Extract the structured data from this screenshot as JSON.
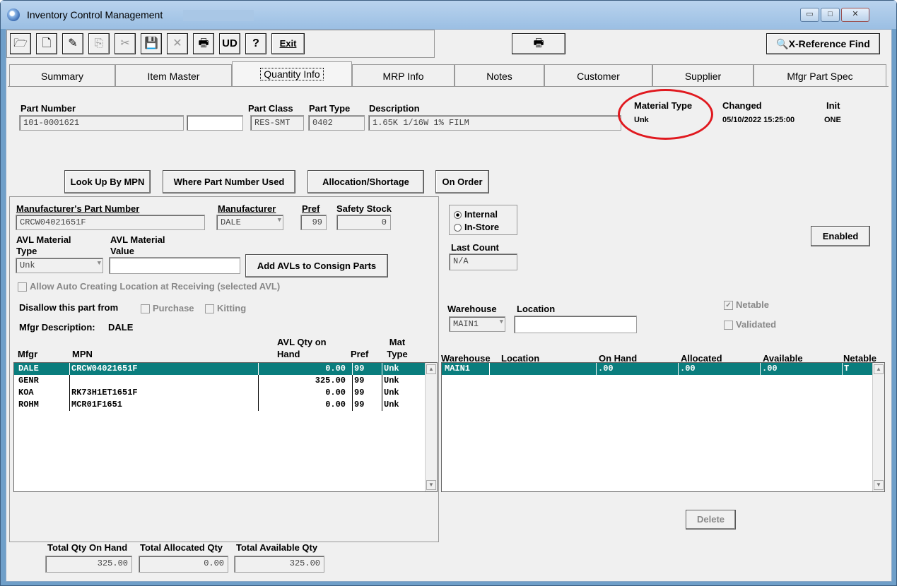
{
  "window": {
    "title": "Inventory Control Management",
    "min": "▭",
    "max": "□",
    "close": "✕"
  },
  "toolbar": {
    "exit_label": "Exit",
    "print": "🖶",
    "xref_label": "X-Reference Find"
  },
  "tabs": [
    "Summary",
    "Item Master",
    "Quantity Info",
    "MRP Info",
    "Notes",
    "Customer",
    "Supplier",
    "Mfgr Part Spec"
  ],
  "header": {
    "part_number_label": "Part Number",
    "part_number": "101-0001621",
    "part_class_label": "Part Class",
    "part_class": "RES-SMT",
    "part_type_label": "Part Type",
    "part_type": "0402",
    "description_label": "Description",
    "description": "1.65K 1/16W 1% FILM",
    "material_type_label": "Material Type",
    "material_type": "Unk",
    "changed_label": "Changed",
    "changed": "05/10/2022 15:25:00",
    "init_label": "Init",
    "init": "ONE"
  },
  "actions": {
    "lookup": "Look Up By MPN",
    "where_used": "Where Part Number Used",
    "allocation": "Allocation/Shortage",
    "on_order": "On Order"
  },
  "mfr": {
    "mpn_label": "Manufacturer's Part Number",
    "mpn": "CRCW04021651F",
    "manufacturer_label": "Manufacturer",
    "manufacturer": "DALE",
    "pref_label": "Pref",
    "pref": "99",
    "safety_label": "Safety Stock",
    "safety": "0",
    "avl_type_label": "AVL Material Type",
    "avl_type": "Unk",
    "avl_value_label": "AVL Material Value",
    "avl_value": "",
    "add_avl": "Add AVLs to Consign Parts",
    "allow_auto": "Allow Auto Creating Location at Receiving (selected AVL)",
    "disallow": "Disallow this part from",
    "purchase": "Purchase",
    "kitting": "Kitting",
    "desc_label": "Mfgr Description:",
    "desc": "DALE"
  },
  "avl_table": {
    "headers": [
      "Mfgr",
      "MPN",
      "AVL Qty on Hand",
      "Pref",
      "Mat Type"
    ],
    "rows": [
      [
        "DALE",
        "CRCW04021651F",
        "0.00",
        "99",
        "Unk"
      ],
      [
        "GENR",
        "",
        "325.00",
        "99",
        "Unk"
      ],
      [
        "KOA",
        "RK73H1ET1651F",
        "0.00",
        "99",
        "Unk"
      ],
      [
        "ROHM",
        "MCR01F1651",
        "0.00",
        "99",
        "Unk"
      ]
    ]
  },
  "right": {
    "internal": "Internal",
    "instore": "In-Store",
    "enabled": "Enabled",
    "last_count_label": "Last Count",
    "last_count": "N/A",
    "warehouse_label": "Warehouse",
    "warehouse": "MAIN1",
    "location_label": "Location",
    "location": "",
    "netable": "Netable",
    "validated": "Validated"
  },
  "wh_table": {
    "headers": [
      "Warehouse",
      "Location",
      "On Hand",
      "Allocated",
      "Available",
      "Netable"
    ],
    "rows": [
      [
        "MAIN1",
        "",
        ".00",
        ".00",
        ".00",
        "T"
      ]
    ]
  },
  "delete_label": "Delete",
  "totals": {
    "on_hand_label": "Total Qty On Hand",
    "on_hand": "325.00",
    "allocated_label": "Total Allocated Qty",
    "allocated": "0.00",
    "available_label": "Total Available Qty",
    "available": "325.00"
  }
}
